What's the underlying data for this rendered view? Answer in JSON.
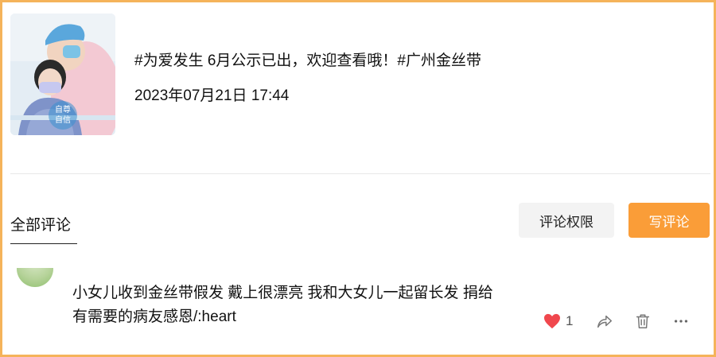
{
  "post": {
    "thumbnail_icon": "hospital-nurse-girl-photo",
    "thumbnail_badge_line1": "自尊",
    "thumbnail_badge_line2": "自信",
    "title": "#为爱发生 6月公示已出，欢迎查看哦！#广州金丝带",
    "timestamp": "2023年07月21日 17:44"
  },
  "comments_header": {
    "tab_label": "全部评论",
    "permissions_button": "评论权限",
    "write_button": "写评论"
  },
  "comments": [
    {
      "text": "小女儿收到金丝带假发 戴上很漂亮 我和大女儿一起留长发 捐给有需要的病友感恩/:heart",
      "like_count": "1",
      "icons": [
        "heart-icon",
        "share-icon",
        "trash-icon",
        "more-icon"
      ]
    }
  ],
  "colors": {
    "frame_border": "#f5b35a",
    "accent": "#fa9d38",
    "like_heart": "#f0474d"
  }
}
